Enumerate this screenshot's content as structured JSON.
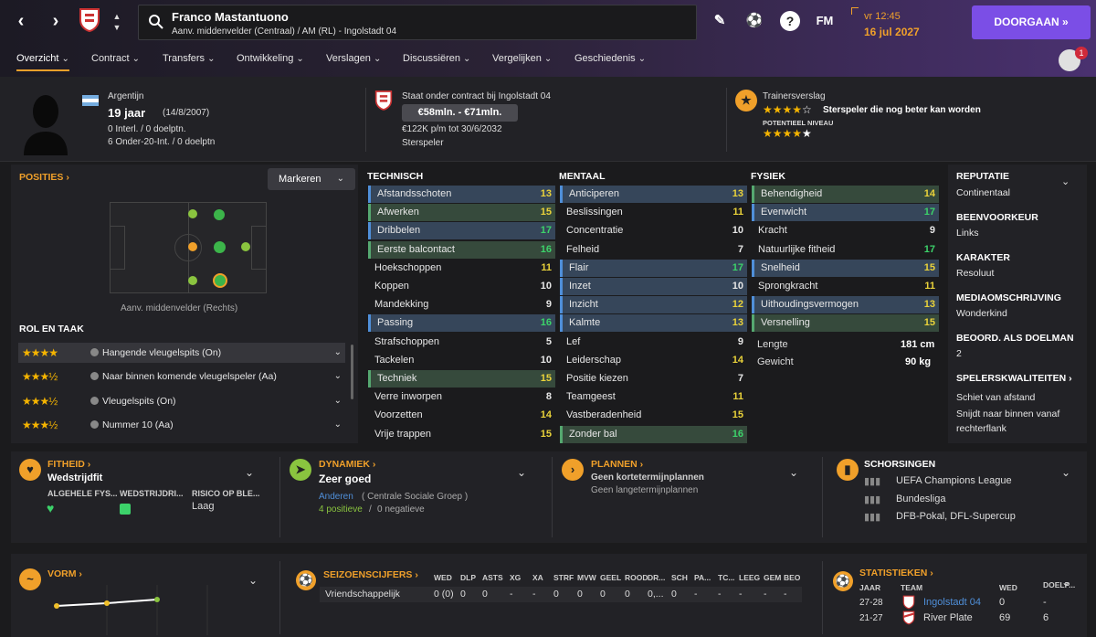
{
  "player": {
    "name": "Franco Mastantuono",
    "subtitle": "Aanv. middenvelder (Centraal) / AM (RL) - Ingolstadt 04"
  },
  "topbar": {
    "time": "vr 12:45",
    "date": "16 jul 2027",
    "continue_label": "DOORGAAN",
    "fm_label": "FM",
    "notification_count": "1"
  },
  "tabs": [
    "Overzicht",
    "Contract",
    "Transfers",
    "Ontwikkeling",
    "Verslagen",
    "Discussiëren",
    "Vergelijken",
    "Geschiedenis"
  ],
  "header": {
    "nationality": "Argentijn",
    "age": "19 jaar",
    "dob": "(14/8/2007)",
    "caps": "0 Interl. / 0 doelptn.",
    "u20": "6 Onder-20-Int. / 0 doelptn",
    "contract": "Staat onder contract bij Ingolstadt 04",
    "value": "€58mln. - €71mln.",
    "wage": "€122K p/m tot 30/6/2032",
    "status": "Sterspeler",
    "coach_title": "Trainersverslag",
    "coach_summary": "Sterspeler die nog beter kan worden",
    "potential_label": "POTENTIEEL NIVEAU",
    "current_stars": 4,
    "potential_stars": 4.5
  },
  "positions": {
    "title": "POSITIES",
    "highlight_button": "Markeren",
    "caption": "Aanv. middenvelder (Rechts)",
    "role_title": "ROL EN TAAK",
    "roles": [
      {
        "stars": 4,
        "name": "Hangende vleugelspits (On)"
      },
      {
        "stars": 3.5,
        "name": "Naar binnen komende vleugelspeler (Aa)"
      },
      {
        "stars": 3.5,
        "name": "Vleugelspits (On)"
      },
      {
        "stars": 3.5,
        "name": "Nummer 10 (Aa)"
      }
    ]
  },
  "attributes": {
    "technical_title": "TECHNISCH",
    "mental_title": "MENTAAL",
    "physical_title": "FYSIEK",
    "technical": [
      {
        "name": "Afstandsschoten",
        "value": "13",
        "hl": "b"
      },
      {
        "name": "Afwerken",
        "value": "15",
        "hl": "g"
      },
      {
        "name": "Dribbelen",
        "value": "17",
        "hl": "b"
      },
      {
        "name": "Eerste balcontact",
        "value": "16",
        "hl": "g"
      },
      {
        "name": "Hoekschoppen",
        "value": "11",
        "hl": ""
      },
      {
        "name": "Koppen",
        "value": "10",
        "hl": ""
      },
      {
        "name": "Mandekking",
        "value": "9",
        "hl": ""
      },
      {
        "name": "Passing",
        "value": "16",
        "hl": "b"
      },
      {
        "name": "Strafschoppen",
        "value": "5",
        "hl": ""
      },
      {
        "name": "Tackelen",
        "value": "10",
        "hl": ""
      },
      {
        "name": "Techniek",
        "value": "15",
        "hl": "g"
      },
      {
        "name": "Verre inworpen",
        "value": "8",
        "hl": ""
      },
      {
        "name": "Voorzetten",
        "value": "14",
        "hl": ""
      },
      {
        "name": "Vrije trappen",
        "value": "15",
        "hl": ""
      }
    ],
    "mental": [
      {
        "name": "Anticiperen",
        "value": "13",
        "hl": "b"
      },
      {
        "name": "Beslissingen",
        "value": "11",
        "hl": ""
      },
      {
        "name": "Concentratie",
        "value": "10",
        "hl": ""
      },
      {
        "name": "Felheid",
        "value": "7",
        "hl": ""
      },
      {
        "name": "Flair",
        "value": "17",
        "hl": "b"
      },
      {
        "name": "Inzet",
        "value": "10",
        "hl": "b"
      },
      {
        "name": "Inzicht",
        "value": "12",
        "hl": "b"
      },
      {
        "name": "Kalmte",
        "value": "13",
        "hl": "b"
      },
      {
        "name": "Lef",
        "value": "9",
        "hl": ""
      },
      {
        "name": "Leiderschap",
        "value": "14",
        "hl": ""
      },
      {
        "name": "Positie kiezen",
        "value": "7",
        "hl": ""
      },
      {
        "name": "Teamgeest",
        "value": "11",
        "hl": ""
      },
      {
        "name": "Vastberadenheid",
        "value": "15",
        "hl": ""
      },
      {
        "name": "Zonder bal",
        "value": "16",
        "hl": "g"
      }
    ],
    "physical": [
      {
        "name": "Behendigheid",
        "value": "14",
        "hl": "g"
      },
      {
        "name": "Evenwicht",
        "value": "17",
        "hl": "b"
      },
      {
        "name": "Kracht",
        "value": "9",
        "hl": ""
      },
      {
        "name": "Natuurlijke fitheid",
        "value": "17",
        "hl": ""
      },
      {
        "name": "Snelheid",
        "value": "15",
        "hl": "b"
      },
      {
        "name": "Sprongkracht",
        "value": "11",
        "hl": ""
      },
      {
        "name": "Uithoudingsvermogen",
        "value": "13",
        "hl": "b"
      },
      {
        "name": "Versnelling",
        "value": "15",
        "hl": "g"
      }
    ],
    "height_label": "Lengte",
    "height": "181 cm",
    "weight_label": "Gewicht",
    "weight": "90 kg"
  },
  "info": {
    "reputation_h": "REPUTATIE",
    "reputation": "Continentaal",
    "foot_h": "BEENVOORKEUR",
    "foot": "Links",
    "character_h": "KARAKTER",
    "character": "Resoluut",
    "media_h": "MEDIAOMSCHRIJVING",
    "media": "Wonderkind",
    "gk_h": "BEOORD. ALS DOELMAN",
    "gk": "2",
    "traits_h": "SPELERSKWALITEITEN",
    "trait1": "Schiet van afstand",
    "trait2": "Snijdt naar binnen vanaf",
    "trait3": "rechterflank"
  },
  "fitness": {
    "title": "FITHEID",
    "value": "Wedstrijdfit",
    "col1": "ALGEHELE FYS...",
    "col2": "WEDSTRIJDRI...",
    "col3": "RISICO OP BLE...",
    "risk": "Laag"
  },
  "dynamics": {
    "title": "DYNAMIEK",
    "value": "Zeer goed",
    "group_link": "Anderen",
    "group": "( Centrale Sociale Groep )",
    "pos": "4 positieve",
    "slash": "/",
    "neg": "0 negatieve"
  },
  "plans": {
    "title": "PLANNEN",
    "short": "Geen kortetermijnplannen",
    "long": "Geen langetermijnplannen"
  },
  "bans": {
    "title": "SCHORSINGEN",
    "items": [
      "UEFA Champions League",
      "Bundesliga",
      "DFB-Pokal, DFL-Supercup"
    ]
  },
  "form": {
    "title": "VORM"
  },
  "season": {
    "title": "SEIZOENSCIJFERS",
    "headers": [
      "WED",
      "DLP",
      "ASTS",
      "XG",
      "XA",
      "STRF",
      "MVW",
      "GEEL",
      "ROOD",
      "DR...",
      "SCH",
      "PA...",
      "TC...",
      "LEEG",
      "GEM",
      "BEO"
    ],
    "row_label": "Vriendschappelijk",
    "row": [
      "0 (0)",
      "0",
      "0",
      "-",
      "-",
      "0",
      "0",
      "0",
      "0",
      "0,...",
      "0",
      "-",
      "-",
      "-",
      "-",
      "-"
    ]
  },
  "stats": {
    "title": "STATISTIEKEN",
    "h_year": "JAAR",
    "h_team": "TEAM",
    "h_wed": "WED",
    "h_goals": "DOELP...",
    "rows": [
      {
        "year": "27-28",
        "team": "Ingolstadt 04",
        "wed": "0",
        "goals": "-"
      },
      {
        "year": "21-27",
        "team": "River Plate",
        "wed": "69",
        "goals": "6"
      }
    ]
  },
  "colors": {
    "accent": "#f0a02a",
    "primary_button": "#7b4ee6",
    "good": "#8ac43f",
    "blue_hl": "#4f8fd9"
  }
}
